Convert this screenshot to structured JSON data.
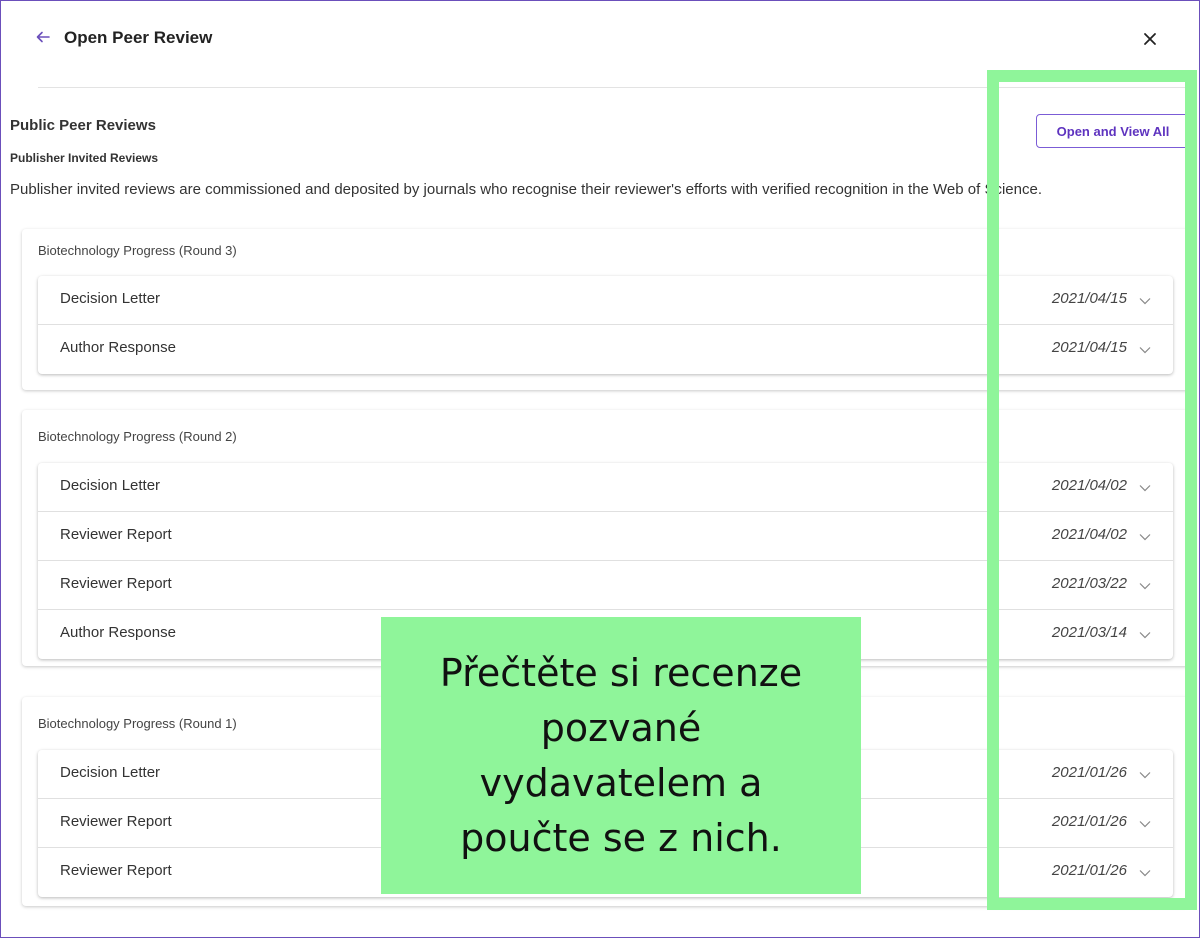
{
  "header": {
    "title": "Open Peer Review",
    "back_icon": "arrow-left-icon",
    "close_icon": "close-icon",
    "accent_color": "#6b4fbb"
  },
  "section": {
    "title": "Public Peer Reviews",
    "open_all_label": "Open and View All",
    "subsection_title": "Publisher Invited Reviews",
    "description": "Publisher invited reviews are commissioned and deposited by journals who recognise their reviewer's efforts with verified recognition in the Web of Science."
  },
  "rounds": [
    {
      "title": "Biotechnology Progress (Round 3)",
      "items": [
        {
          "label": "Decision Letter",
          "date": "2021/04/15"
        },
        {
          "label": "Author Response",
          "date": "2021/04/15"
        }
      ]
    },
    {
      "title": "Biotechnology Progress (Round 2)",
      "items": [
        {
          "label": "Decision Letter",
          "date": "2021/04/02"
        },
        {
          "label": "Reviewer Report",
          "date": "2021/04/02"
        },
        {
          "label": "Reviewer Report",
          "date": "2021/03/22"
        },
        {
          "label": "Author Response",
          "date": "2021/03/14"
        }
      ]
    },
    {
      "title": "Biotechnology Progress (Round 1)",
      "items": [
        {
          "label": "Decision Letter",
          "date": "2021/01/26"
        },
        {
          "label": "Reviewer Report",
          "date": "2021/01/26"
        },
        {
          "label": "Reviewer Report",
          "date": "2021/01/26"
        }
      ]
    }
  ],
  "overlay": {
    "note": "Přečtěte si recenze pozvané vydavatelem a poučte se z nich.",
    "highlight_color": "#8ff59a"
  }
}
